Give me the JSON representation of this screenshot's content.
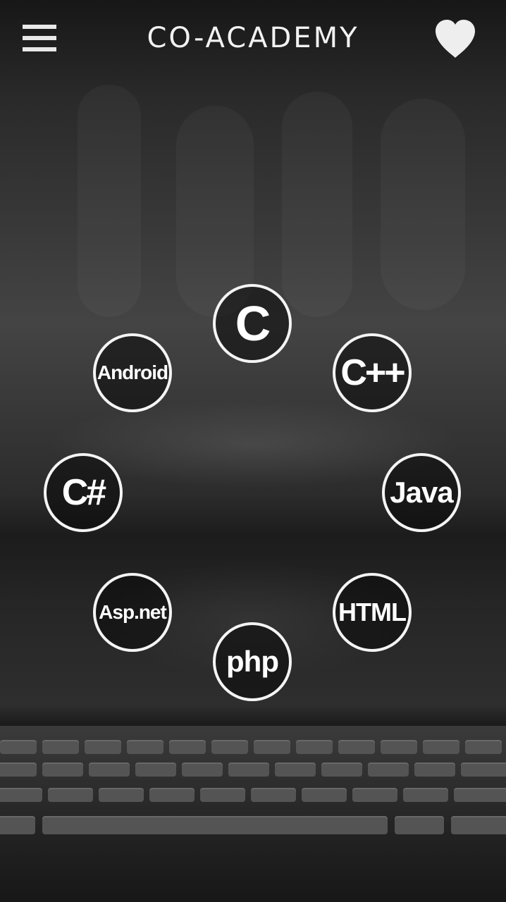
{
  "header": {
    "menu_icon": "hamburger-menu-icon",
    "title": "CO-ACADEMY",
    "favorite_icon": "heart-icon"
  },
  "colors": {
    "text": "#ffffff",
    "circle_border": "#f4f4f4",
    "background": "#2e2e2e"
  },
  "languages": [
    {
      "id": "c",
      "label": "C"
    },
    {
      "id": "cpp",
      "label": "C++"
    },
    {
      "id": "java",
      "label": "Java"
    },
    {
      "id": "html",
      "label": "HTML"
    },
    {
      "id": "php",
      "label": "php"
    },
    {
      "id": "aspnet",
      "label": "Asp.net"
    },
    {
      "id": "csharp",
      "label": "C#"
    },
    {
      "id": "android",
      "label": "Android"
    }
  ]
}
